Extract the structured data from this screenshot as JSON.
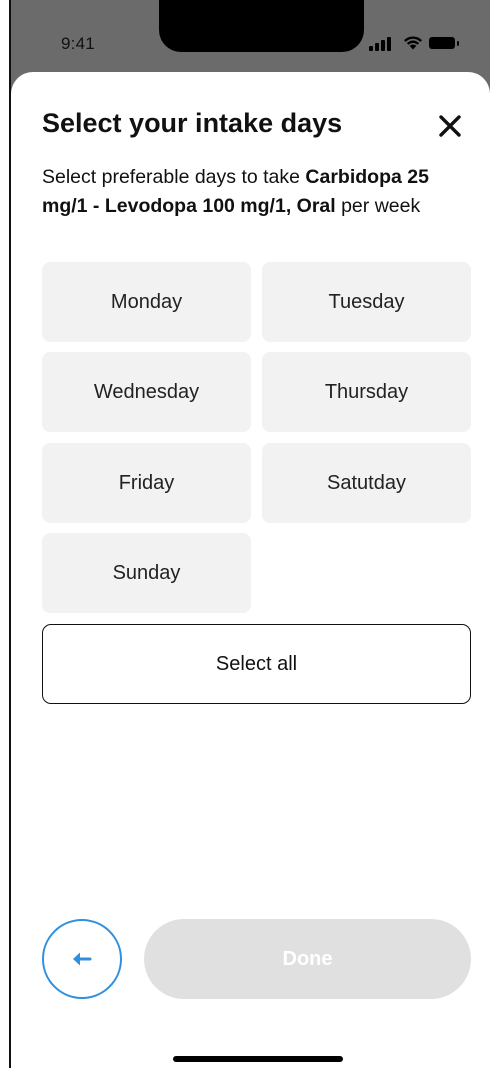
{
  "status_bar": {
    "time": "9:41"
  },
  "sheet": {
    "title": "Select your intake days",
    "subtitle_prefix": "Select preferable days to take ",
    "medication": "Carbidopa 25 mg/1 - Levodopa 100 mg/1, Oral",
    "subtitle_suffix": " per week",
    "days": [
      {
        "label": "Monday",
        "selected": false
      },
      {
        "label": "Tuesday",
        "selected": false
      },
      {
        "label": "Wednesday",
        "selected": false
      },
      {
        "label": "Thursday",
        "selected": false
      },
      {
        "label": "Friday",
        "selected": false
      },
      {
        "label": "Satutday",
        "selected": false
      },
      {
        "label": "Sunday",
        "selected": false
      }
    ],
    "select_all_label": "Select all",
    "done_label": "Done",
    "done_enabled": false
  },
  "icons": {
    "close": "close-icon",
    "back": "arrow-left-icon"
  },
  "colors": {
    "accent": "#2f8fe0",
    "day_tile_bg": "#f2f2f2",
    "done_disabled_bg": "#e0e0e0"
  }
}
